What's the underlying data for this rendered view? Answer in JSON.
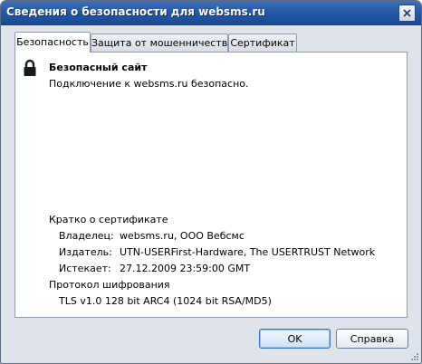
{
  "window": {
    "title": "Сведения о безопасности для websms.ru"
  },
  "tabs": [
    {
      "label": "Безопасность",
      "active": true
    },
    {
      "label": "Защита от мошенничества",
      "active": false
    },
    {
      "label": "Сертификат",
      "active": false
    }
  ],
  "security": {
    "icon": "lock-icon",
    "heading": "Безопасный сайт",
    "description": "Подключение к websms.ru безопасно."
  },
  "certificate": {
    "heading": "Кратко о сертификате",
    "owner_label": "Владелец:",
    "owner_value": "websms.ru, ООО Вебсмс",
    "issuer_label": "Издатель:",
    "issuer_value": "UTN-USERFirst-Hardware, The USERTRUST Network",
    "expires_label": "Истекает:",
    "expires_value": "27.12.2009 23:59:00 GMT"
  },
  "protocol": {
    "heading": "Протокол шифрования",
    "value": "TLS v1.0 128 bit ARC4 (1024 bit RSA/MD5)"
  },
  "buttons": {
    "ok": "OK",
    "help": "Справка"
  },
  "colors": {
    "titlebar": "#2558a5",
    "dialog_bg": "#dfe4ec",
    "panel_bg": "#ffffff"
  }
}
